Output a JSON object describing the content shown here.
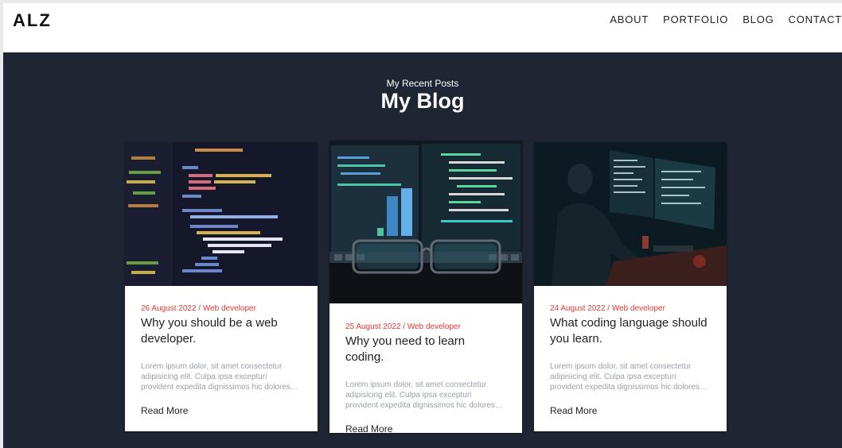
{
  "brand": {
    "logo": "ALZ"
  },
  "nav": {
    "items": [
      "ABOUT",
      "PORTFOLIO",
      "BLOG",
      "CONTACT"
    ]
  },
  "section": {
    "subtitle": "My Recent Posts",
    "title": "My Blog"
  },
  "posts": [
    {
      "meta": "26 August 2022 / Web developer",
      "title": "Why you should be a web developer.",
      "excerpt": "Lorem ipsum dolor, sit amet consectetur adipisicing elit. Culpa ipsa excepturi provident expedita dignissimos hic dolores…",
      "link": "Read More"
    },
    {
      "meta": "25 August 2022 / Web developer",
      "title": "Why you need to learn coding.",
      "excerpt": "Lorem ipsum dolor, sit amet consectetur adipisicing elit. Culpa ipsa excepturi provident expedita dignissimos hic dolores…",
      "link": "Read More"
    },
    {
      "meta": "24 August 2022 / Web developer",
      "title": "What coding language should you learn.",
      "excerpt": "Lorem ipsum dolor, sit amet consectetur adipisicing elit. Culpa ipsa excepturi provident expedita dignissimos hic dolores…",
      "link": "Read More"
    }
  ],
  "colors": {
    "background": "#1f2633",
    "accent": "#e53935"
  }
}
